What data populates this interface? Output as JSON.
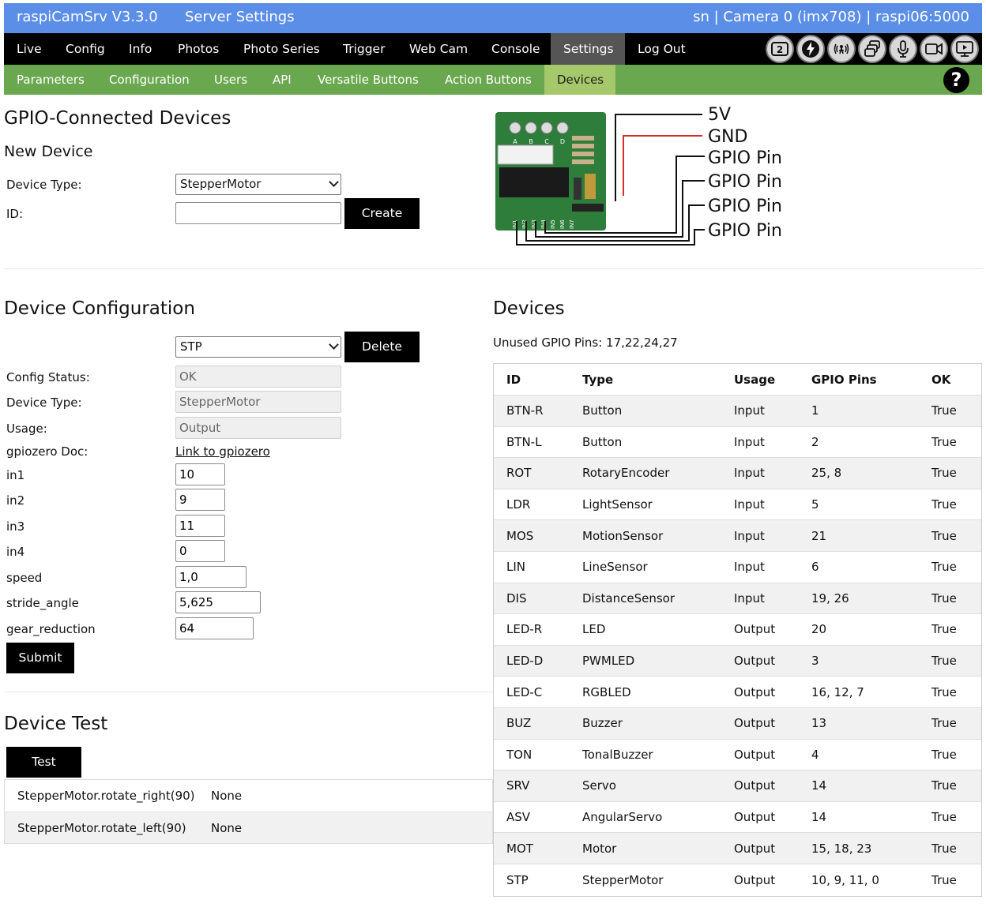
{
  "titlebar": {
    "app": "raspiCamSrv V3.3.0",
    "page": "Server Settings",
    "status": "sn | Camera 0 (imx708) | raspi06:5000"
  },
  "mainnav": [
    "Live",
    "Config",
    "Info",
    "Photos",
    "Photo Series",
    "Trigger",
    "Web Cam",
    "Console",
    "Settings",
    "Log Out"
  ],
  "mainnav_active": "Settings",
  "toolbar_icons": [
    "camera-2-icon",
    "lightning-icon",
    "motion-sensor-icon",
    "multi-camera-icon",
    "microphone-icon",
    "video-camera-icon",
    "display-icon"
  ],
  "toolbar_icon_badge": "2",
  "subnav": [
    "Parameters",
    "Configuration",
    "Users",
    "API",
    "Versatile Buttons",
    "Action Buttons",
    "Devices"
  ],
  "subnav_active": "Devices",
  "help_label": "?",
  "gpio_section": {
    "title": "GPIO-Connected Devices",
    "new_device_title": "New Device",
    "device_type_label": "Device Type:",
    "device_type_value": "StepperMotor",
    "id_label": "ID:",
    "id_value": "",
    "create_label": "Create"
  },
  "board": {
    "pins": [
      "5V",
      "GND",
      "GPIO Pin",
      "GPIO Pin",
      "GPIO Pin",
      "GPIO Pin"
    ],
    "led_labels": [
      "A",
      "B",
      "C",
      "D"
    ],
    "in_labels": [
      "IN1",
      "IN2",
      "IN3",
      "IN4",
      "IN5",
      "IN6",
      "IN7"
    ]
  },
  "config_section": {
    "title": "Device Configuration",
    "selected_device": "STP",
    "delete_label": "Delete",
    "fields": {
      "config_status_label": "Config Status:",
      "config_status": "OK",
      "device_type_label": "Device Type:",
      "device_type": "StepperMotor",
      "usage_label": "Usage:",
      "usage": "Output",
      "doc_label": "gpiozero Doc:",
      "doc_link": "Link to gpiozero"
    },
    "params": [
      {
        "name": "in1",
        "value": "10"
      },
      {
        "name": "in2",
        "value": "9"
      },
      {
        "name": "in3",
        "value": "11"
      },
      {
        "name": "in4",
        "value": "0"
      },
      {
        "name": "speed",
        "value": "1,0"
      },
      {
        "name": "stride_angle",
        "value": "5,625"
      },
      {
        "name": "gear_reduction",
        "value": "64"
      }
    ],
    "submit_label": "Submit"
  },
  "test_section": {
    "title": "Device Test",
    "test_label": "Test",
    "results": [
      {
        "call": "StepperMotor.rotate_right(90)",
        "result": "None"
      },
      {
        "call": "StepperMotor.rotate_left(90)",
        "result": "None"
      }
    ]
  },
  "devices_section": {
    "title": "Devices",
    "unused_pins": "Unused GPIO Pins: 17,22,24,27",
    "columns": [
      "ID",
      "Type",
      "Usage",
      "GPIO Pins",
      "OK"
    ],
    "rows": [
      [
        "BTN-R",
        "Button",
        "Input",
        "1",
        "True"
      ],
      [
        "BTN-L",
        "Button",
        "Input",
        "2",
        "True"
      ],
      [
        "ROT",
        "RotaryEncoder",
        "Input",
        "25, 8",
        "True"
      ],
      [
        "LDR",
        "LightSensor",
        "Input",
        "5",
        "True"
      ],
      [
        "MOS",
        "MotionSensor",
        "Input",
        "21",
        "True"
      ],
      [
        "LIN",
        "LineSensor",
        "Input",
        "6",
        "True"
      ],
      [
        "DIS",
        "DistanceSensor",
        "Input",
        "19, 26",
        "True"
      ],
      [
        "LED-R",
        "LED",
        "Output",
        "20",
        "True"
      ],
      [
        "LED-D",
        "PWMLED",
        "Output",
        "3",
        "True"
      ],
      [
        "LED-C",
        "RGBLED",
        "Output",
        "16, 12, 7",
        "True"
      ],
      [
        "BUZ",
        "Buzzer",
        "Output",
        "13",
        "True"
      ],
      [
        "TON",
        "TonalBuzzer",
        "Output",
        "4",
        "True"
      ],
      [
        "SRV",
        "Servo",
        "Output",
        "14",
        "True"
      ],
      [
        "ASV",
        "AngularServo",
        "Output",
        "14",
        "True"
      ],
      [
        "MOT",
        "Motor",
        "Output",
        "15, 18, 23",
        "True"
      ],
      [
        "STP",
        "StepperMotor",
        "Output",
        "10, 9, 11, 0",
        "True"
      ]
    ]
  },
  "colors": {
    "titlebar": "#5b8ee6",
    "mainnav": "#000000",
    "mainnav_active": "#555555",
    "subnav": "#6aa84f",
    "subnav_active": "#a5c86a",
    "board_green": "#2e7d3a",
    "gnd_wire": "#d32f2f"
  }
}
